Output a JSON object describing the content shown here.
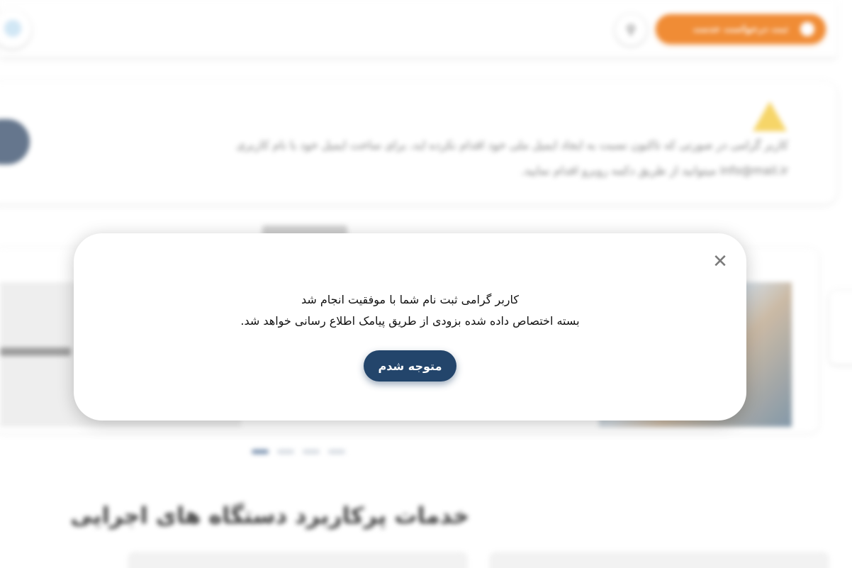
{
  "header": {
    "cta_label": "ثبت درخواست خدمت",
    "search_icon": "search-icon",
    "cta_icon": "plus-icon"
  },
  "notice": {
    "icon": "warning-icon",
    "line1": "کاربر گرامی در صورتی که تاکنون نسبت به ایجاد ایمیل ملی خود اقدام نکرده اید، برای ساخت ایمیل خود با نام کاربری",
    "line2": "info@mail.ir میتوانید از طریق دکمه روبرو اقدام نمایید."
  },
  "services": {
    "title": "خدمات پرکاربرد دستگاه های اجرایی"
  },
  "slider": {
    "dot_count": 4,
    "active_dot": 4
  },
  "modal": {
    "close_icon": "close-icon",
    "close_symbol": "✕",
    "line1": "کاربر گرامی ثبت نام شما با موفقیت انجام شد",
    "line2": "بسته اختصاص داده شده بزودی از طریق پیامک اطلاع رسانی خواهد شد.",
    "confirm_label": "متوجه شدم"
  },
  "colors": {
    "cta": "#f0862b",
    "primary_button": "#23456b",
    "warning": "#f6d360"
  }
}
